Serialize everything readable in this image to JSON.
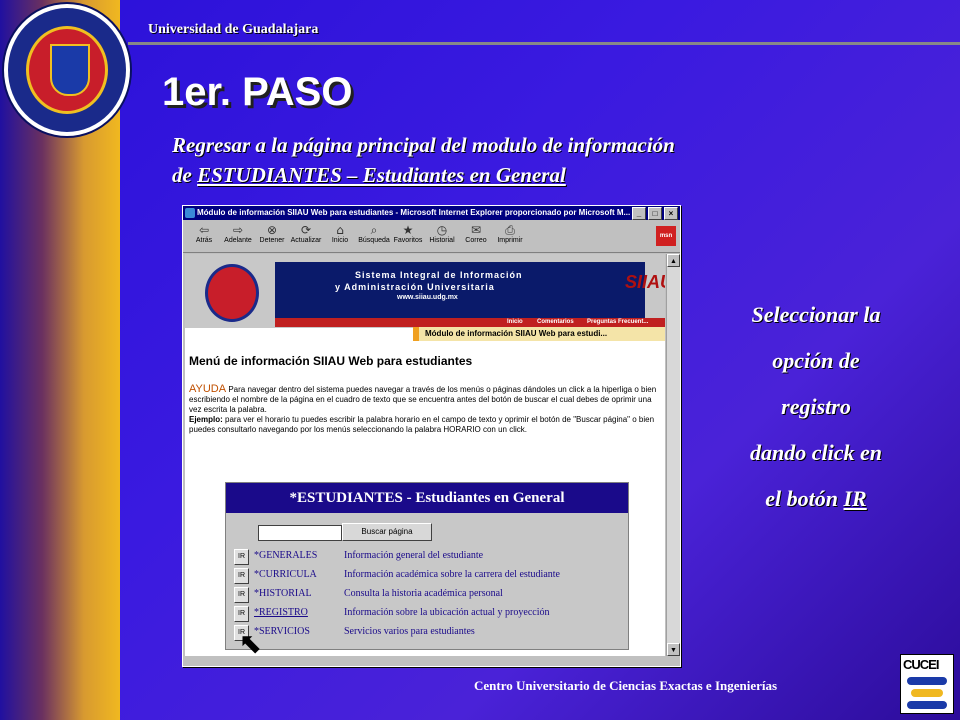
{
  "header": {
    "university": "Universidad de Guadalajara",
    "step_title": "1er. PASO",
    "instruction_line1": "Regresar a la página principal del modulo de información",
    "instruction_prefix": "de ",
    "instruction_link": "ESTUDIANTES – Estudiantes en General"
  },
  "side_note": {
    "line1": "Seleccionar la",
    "line2": "opción de",
    "line3": "registro",
    "line4": "dando click en",
    "line5_prefix": "el botón ",
    "line5_link": "IR"
  },
  "footer": {
    "center": "Centro Universitario de Ciencias Exactas e Ingenierías",
    "logo_text": "CUCEI"
  },
  "browser": {
    "window_title": "Módulo de información SIIAU Web para estudiantes - Microsoft Internet Explorer proporcionado por Microsoft M...",
    "toolbar": [
      {
        "label": "Atrás",
        "icon": "back-arrow-icon",
        "glyph": "⇦"
      },
      {
        "label": "Adelante",
        "icon": "forward-arrow-icon",
        "glyph": "⇨"
      },
      {
        "label": "Detener",
        "icon": "stop-icon",
        "glyph": "⊗"
      },
      {
        "label": "Actualizar",
        "icon": "refresh-icon",
        "glyph": "⟳"
      },
      {
        "label": "Inicio",
        "icon": "home-icon",
        "glyph": "⌂"
      },
      {
        "label": "Búsqueda",
        "icon": "search-icon",
        "glyph": "⌕"
      },
      {
        "label": "Favoritos",
        "icon": "favorites-icon",
        "glyph": "★"
      },
      {
        "label": "Historial",
        "icon": "history-icon",
        "glyph": "◷"
      },
      {
        "label": "Correo",
        "icon": "mail-icon",
        "glyph": "✉"
      },
      {
        "label": "Imprimir",
        "icon": "print-icon",
        "glyph": "⎙"
      }
    ],
    "page": {
      "banner_line1": "Sistema Integral de Información",
      "banner_line2": "y Administración Universitaria",
      "banner_url": "www.siiau.udg.mx",
      "banner_brand": "SIIAU",
      "nav_links": [
        "Inicio",
        "Comentarios",
        "Preguntas Frecuent..."
      ],
      "module_bar": "Módulo de información SIIAU Web para estudi...",
      "menu_title": "Menú de información SIIAU Web para estudiantes",
      "ayuda_label": "AYUDA",
      "ayuda_text": " Para navegar dentro del sistema puedes navegar a través de los menús o páginas dándoles un click a la hiperliga o bien escribiendo el nombre de la página en el cuadro de texto que se encuentra antes del botón de buscar el cual debes de oprimir una vez escrita la palabra.",
      "ejemplo_label": "Ejemplo:",
      "ejemplo_text": " para ver el horario tu puedes escribir la palabra horario en el campo de texto y oprimir el botón de \"Buscar página\" o bien puedes consultarlo navegando por los menús seleccionando la palabra HORARIO con un click.",
      "panel_title": "*ESTUDIANTES - Estudiantes en General",
      "search_button": "Buscar página",
      "search_value": "",
      "ir_label": "IR",
      "rows": [
        {
          "code": "*GENERALES",
          "desc": "Información general del estudiante"
        },
        {
          "code": "*CURRICULA",
          "desc": "Información académica sobre la carrera del estudiante"
        },
        {
          "code": "*HISTORIAL",
          "desc": "Consulta la historia académica personal"
        },
        {
          "code": "*REGISTRO",
          "desc": "Información sobre la ubicación actual y proyección"
        },
        {
          "code": "*SERVICIOS",
          "desc": "Servicios varios para estudiantes"
        }
      ]
    }
  }
}
